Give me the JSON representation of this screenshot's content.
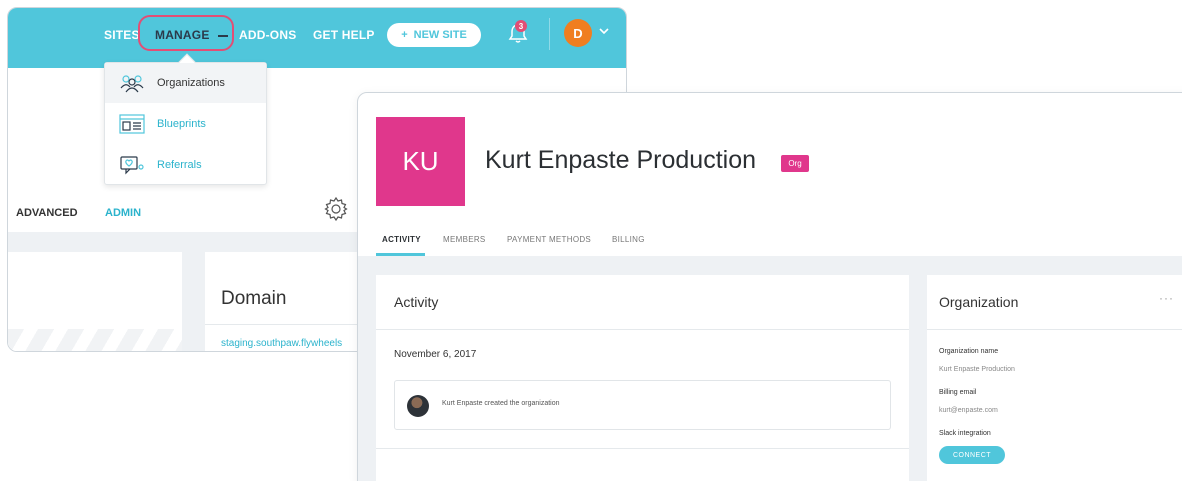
{
  "colors": {
    "brand": "#50c6db",
    "accent_pink": "#e0378c",
    "highlight_ring": "#e24e75",
    "avatar_orange": "#f07e20"
  },
  "nav": {
    "sites": "SITES",
    "manage": "MANAGE",
    "addons": "ADD-ONS",
    "help": "GET HELP",
    "new_site": "NEW SITE",
    "new_site_icon": "plus-icon",
    "notification_count": "3",
    "user_initial": "D"
  },
  "manage_menu": {
    "items": [
      {
        "label": "Organizations",
        "icon": "people-icon"
      },
      {
        "label": "Blueprints",
        "icon": "blueprint-icon"
      },
      {
        "label": "Referrals",
        "icon": "referral-icon"
      }
    ]
  },
  "back_window": {
    "tabs": [
      "ADVANCED",
      "ADMIN"
    ],
    "domain_title": "Domain",
    "domain_link": "staging.southpaw.flywheels"
  },
  "org": {
    "initials": "KU",
    "name": "Kurt Enpaste Production",
    "badge": "Org",
    "tabs": [
      "ACTIVITY",
      "MEMBERS",
      "PAYMENT METHODS",
      "BILLING"
    ]
  },
  "activity": {
    "title": "Activity",
    "date": "November 6, 2017",
    "entry": "Kurt Enpaste created the organization"
  },
  "organization_panel": {
    "title": "Organization",
    "more": "···",
    "name_label": "Organization name",
    "name_value": "Kurt Enpaste Production",
    "email_label": "Billing email",
    "email_value": "kurt@enpaste.com",
    "slack_label": "Slack integration",
    "connect": "CONNECT"
  }
}
